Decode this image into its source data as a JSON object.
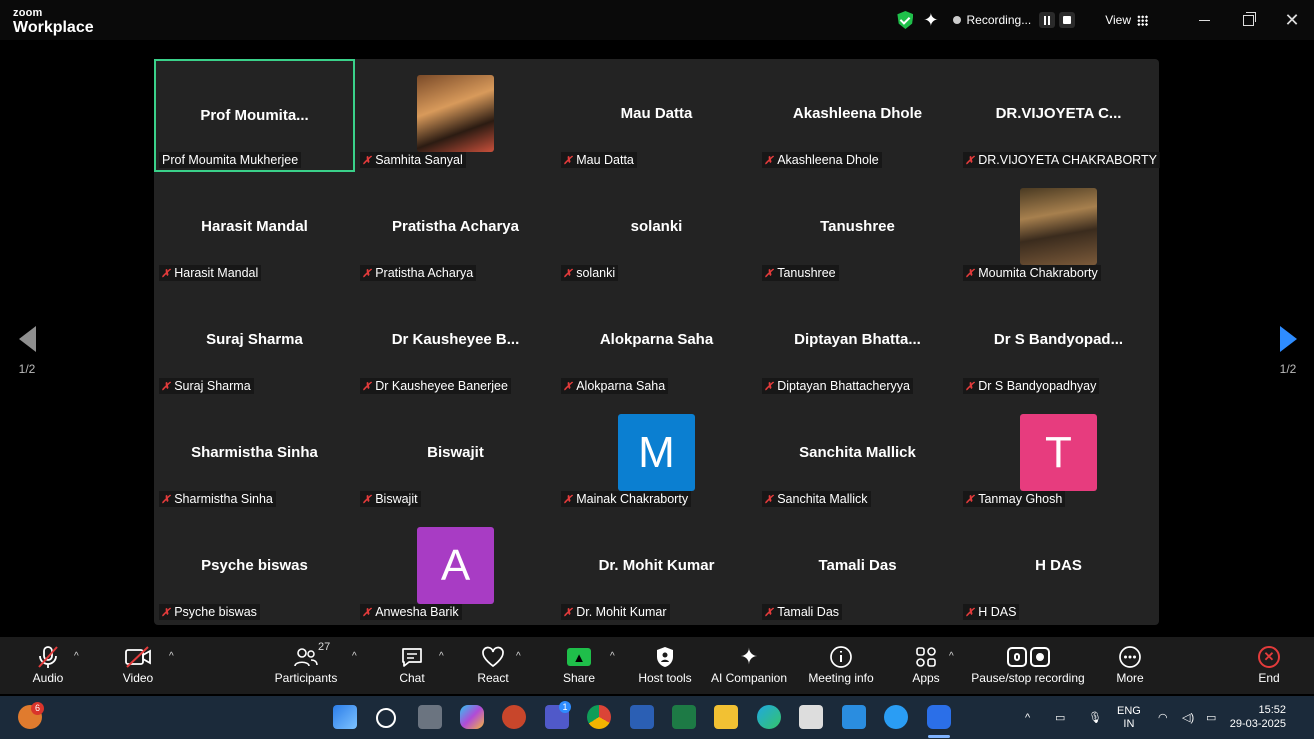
{
  "titlebar": {
    "logo_line1": "zoom",
    "logo_line2": "Workplace",
    "recording_label": "Recording...",
    "view_label": "View",
    "controls": [
      "minimize",
      "restore",
      "close"
    ]
  },
  "pagination": {
    "left": "1/2",
    "right": "1/2"
  },
  "tiles": [
    {
      "name": "Prof  Moumita...",
      "label": "Prof Moumita Mukherjee",
      "muted": false,
      "active": true
    },
    {
      "name": "",
      "label": "Samhita Sanyal",
      "muted": true,
      "avatar": "photo"
    },
    {
      "name": "Mau Datta",
      "label": "Mau Datta",
      "muted": true
    },
    {
      "name": "Akashleena Dhole",
      "label": "Akashleena Dhole",
      "muted": true
    },
    {
      "name": "DR.VIJOYETA C...",
      "label": "DR.VIJOYETA CHAKRABORTY",
      "muted": true
    },
    {
      "name": "Harasit Mandal",
      "label": "Harasit Mandal",
      "muted": true
    },
    {
      "name": "Pratistha Acharya",
      "label": "Pratistha Acharya",
      "muted": true
    },
    {
      "name": "solanki",
      "label": "solanki",
      "muted": true
    },
    {
      "name": "Tanushree",
      "label": "Tanushree",
      "muted": true
    },
    {
      "name": "",
      "label": "Moumita Chakraborty",
      "muted": true,
      "avatar": "photo"
    },
    {
      "name": "Suraj Sharma",
      "label": "Suraj Sharma",
      "muted": true
    },
    {
      "name": "Dr Kausheyee B...",
      "label": "Dr Kausheyee Banerjee",
      "muted": true
    },
    {
      "name": "Alokparna Saha",
      "label": "Alokparna Saha",
      "muted": true
    },
    {
      "name": "Diptayan  Bhatta...",
      "label": "Diptayan Bhattacheryya",
      "muted": true
    },
    {
      "name": "Dr S Bandyopad...",
      "label": "Dr S Bandyopadhyay",
      "muted": true
    },
    {
      "name": "Sharmistha Sinha",
      "label": "Sharmistha Sinha",
      "muted": true
    },
    {
      "name": "Biswajit",
      "label": "Biswajit",
      "muted": true
    },
    {
      "name": "",
      "label": "Mainak Chakraborty",
      "muted": true,
      "avatar": "letter",
      "letter": "M",
      "color": "#0b7fd1"
    },
    {
      "name": "Sanchita Mallick",
      "label": "Sanchita Mallick",
      "muted": true
    },
    {
      "name": "",
      "label": "Tanmay Ghosh",
      "muted": true,
      "avatar": "letter",
      "letter": "T",
      "color": "#e73c7e"
    },
    {
      "name": "Psyche biswas",
      "label": "Psyche biswas",
      "muted": true
    },
    {
      "name": "",
      "label": "Anwesha Barik",
      "muted": true,
      "avatar": "letter",
      "letter": "A",
      "color": "#a83cc4"
    },
    {
      "name": "Dr. Mohit Kumar",
      "label": "Dr. Mohit Kumar",
      "muted": true
    },
    {
      "name": "Tamali Das",
      "label": "Tamali Das",
      "muted": true
    },
    {
      "name": "H DAS",
      "label": "H DAS",
      "muted": true
    }
  ],
  "toolbar": {
    "audio": "Audio",
    "video": "Video",
    "participants": "Participants",
    "participants_count": "27",
    "chat": "Chat",
    "react": "React",
    "share": "Share",
    "host_tools": "Host tools",
    "ai_companion": "AI Companion",
    "meeting_info": "Meeting info",
    "apps": "Apps",
    "pause_stop": "Pause/stop recording",
    "more": "More",
    "end": "End"
  },
  "taskbar": {
    "widget_badge": "6",
    "teams_badge": "1",
    "lang_line1": "ENG",
    "lang_line2": "IN",
    "time": "15:52",
    "date": "29-03-2025",
    "apps": [
      "start-icon",
      "search-icon",
      "task-view-icon",
      "copilot-icon",
      "powerpoint-icon",
      "teams-icon",
      "chrome-icon",
      "word-icon",
      "excel-icon",
      "file-explorer-icon",
      "edge-icon",
      "store-icon",
      "mydesk-icon",
      "safari-icon",
      "zoom-icon"
    ]
  }
}
